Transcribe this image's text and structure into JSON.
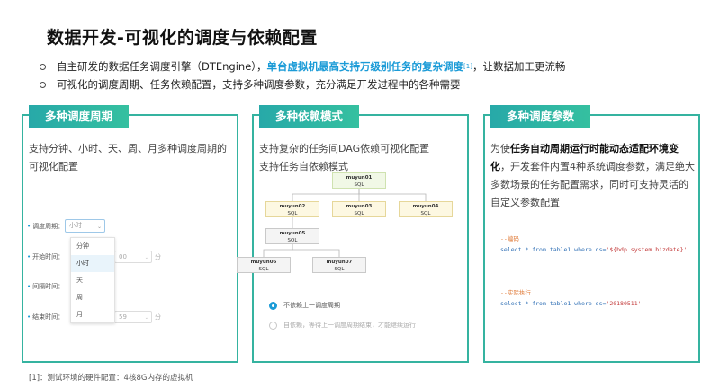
{
  "title": "数据开发-可视化的调度与依赖配置",
  "bullets": {
    "b1_pre": "自主研发的数据任务调度引擎（DTEngine），",
    "b1_hl": "单台虚拟机最高支持万级别任务的复杂调度",
    "b1_sup": "[1]",
    "b1_post": "，让数据加工更流畅",
    "b2": "可视化的调度周期、任务依赖配置，支持多种调度参数，充分满足开发过程中的各种需要"
  },
  "card1": {
    "tag": "多种调度周期",
    "text": "支持分钟、小时、天、周、月多种调度周期的可视化配置",
    "form": {
      "period_label": "调度周期：",
      "period_value": "小时",
      "start_label": "开始时间：",
      "interval_label": "间隔时间：",
      "end_label": "结束时间：",
      "hour_unit": "时",
      "minute_unit": "分",
      "start_minute": "00",
      "end_minute": "59",
      "options": [
        "分钟",
        "小时",
        "天",
        "周",
        "月"
      ]
    }
  },
  "card2": {
    "tag": "多种依赖模式",
    "text_line1": "支持复杂的任务间DAG依赖可视化配置",
    "text_line2": "支持任务自依赖模式",
    "nodes": [
      {
        "name": "muyun01",
        "type": "SQL"
      },
      {
        "name": "muyun02",
        "type": "SQL"
      },
      {
        "name": "muyun03",
        "type": "SQL"
      },
      {
        "name": "muyun04",
        "type": "SQL"
      },
      {
        "name": "muyun05",
        "type": "SQL"
      },
      {
        "name": "muyun06",
        "type": "SQL"
      },
      {
        "name": "muyun07",
        "type": "SQL"
      }
    ],
    "radio1": "不依赖上一调度周期",
    "radio2": "自依赖，等待上一调度周期结束，才能继续运行"
  },
  "card3": {
    "tag": "多种调度参数",
    "text_pre": "为使",
    "text_bold": "任务自动周期运行时能动态适配环境变化",
    "text_post": "，开发套件内置4种系统调度参数，满足绝大多数场景的任务配置需求，同时可支持灵活的自定义参数配置",
    "code1_comment": "--编码",
    "code1_kw": "select * from table1 where ds=",
    "code1_str": "'${bdp.system.bizdate}'",
    "code2_comment": "--实际执行",
    "code2_kw": "select * from table1 where ds=",
    "code2_str": "'20180511'"
  },
  "footnote": "[1]：测试环境的硬件配置：4核8G内存的虚拟机"
}
